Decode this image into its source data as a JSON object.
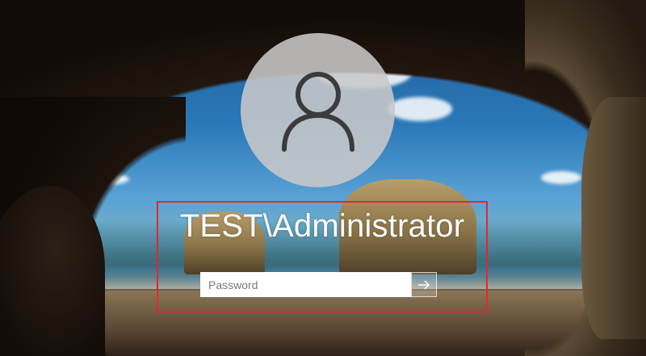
{
  "login": {
    "username": "TEST\\Administrator",
    "password_placeholder": "Password",
    "password_value": ""
  },
  "icons": {
    "avatar": "user-silhouette-icon",
    "submit": "arrow-right-icon"
  },
  "colors": {
    "highlight": "#e4262f",
    "text": "#ffffff",
    "avatar_bg": "#c8c8c8"
  }
}
